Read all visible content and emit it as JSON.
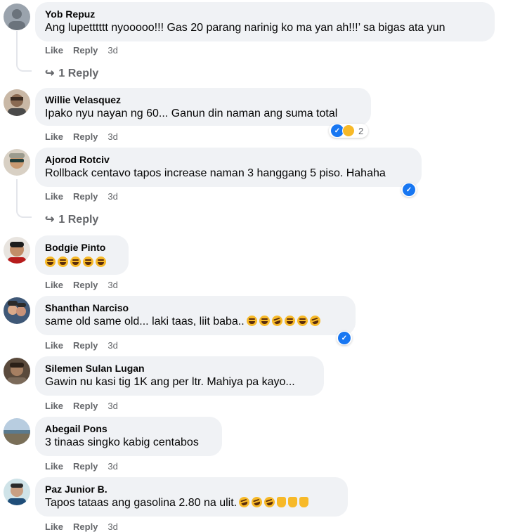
{
  "comments": [
    {
      "author": "Yob Repuz",
      "text": "Ang lupetttttt nyooooo!!! Gas 20 parang narinig ko ma yan ah!!!’ sa bigas ata yun",
      "like": "Like",
      "reply": "Reply",
      "time": "3d",
      "replies_link": "1 Reply"
    },
    {
      "author": "Willie Velasquez",
      "text": "Ipako nyu nayan ng 60... Ganun din naman ang suma total",
      "like": "Like",
      "reply": "Reply",
      "time": "3d",
      "reaction_count": "2"
    },
    {
      "author": "Ajorod Rotciv",
      "text": "Rollback centavo tapos increase naman 3 hanggang 5 piso. Hahaha",
      "like": "Like",
      "reply": "Reply",
      "time": "3d",
      "replies_link": "1 Reply"
    },
    {
      "author": "Bodgie Pinto",
      "text": "",
      "like": "Like",
      "reply": "Reply",
      "time": "3d"
    },
    {
      "author": "Shanthan Narciso",
      "text": "same old same old... laki taas, liit baba..",
      "like": "Like",
      "reply": "Reply",
      "time": "3d"
    },
    {
      "author": "Silemen Sulan Lugan",
      "text": "Gawin nu kasi tig 1K ang per ltr. Mahiya pa kayo...",
      "like": "Like",
      "reply": "Reply",
      "time": "3d"
    },
    {
      "author": "Abegail Pons",
      "text": "3 tinaas singko kabig centabos",
      "like": "Like",
      "reply": "Reply",
      "time": "3d"
    },
    {
      "author": "Paz Junior B.",
      "text": "Tapos tataas ang gasolina 2.80 na ulit.",
      "like": "Like",
      "reply": "Reply",
      "time": "3d"
    }
  ],
  "icons": {
    "reply_arrow": "↪",
    "like_thumb": "👍"
  },
  "colors": {
    "bubble": "#f0f2f5",
    "meta_text": "#65676b",
    "like_blue": "#1877f2",
    "emoji_yellow": "#f7b928"
  }
}
